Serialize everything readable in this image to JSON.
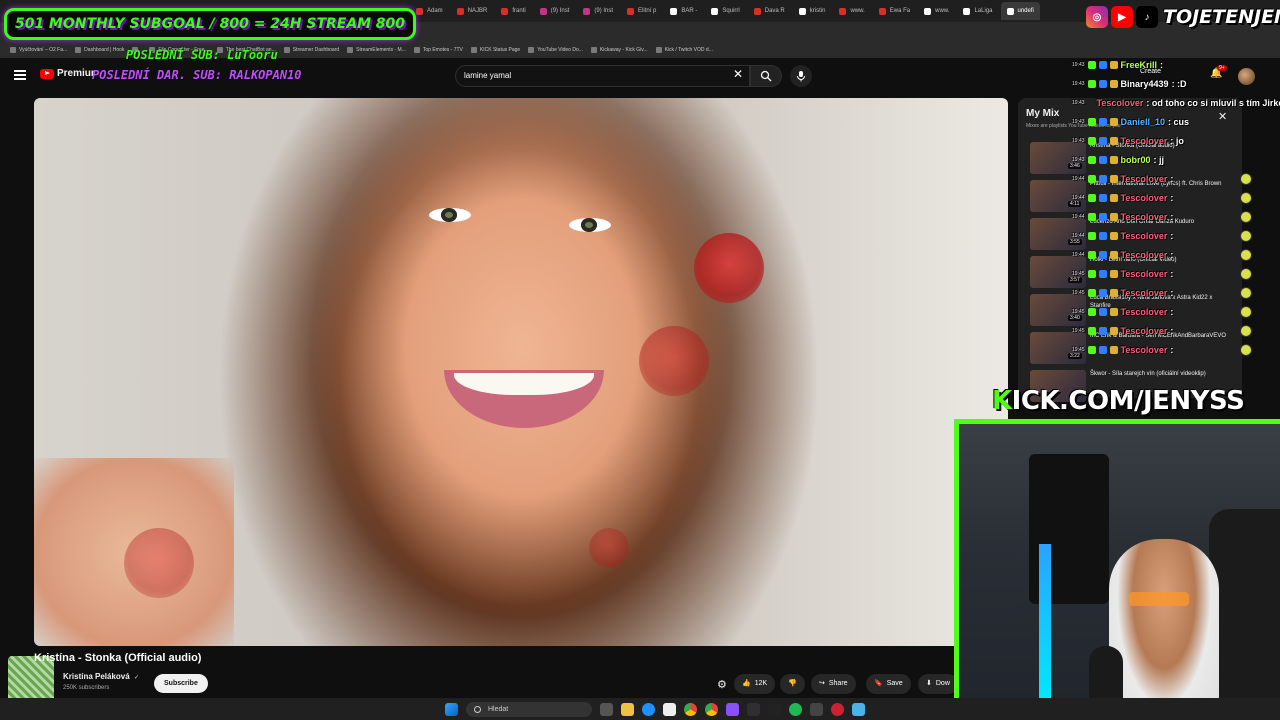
{
  "browser": {
    "tabs": [
      {
        "label": "Adam",
        "color": "#d93025"
      },
      {
        "label": "NAJBR",
        "color": "#d93025"
      },
      {
        "label": "franti",
        "color": "#d93025"
      },
      {
        "label": "(9) Inst",
        "color": "#c13584"
      },
      {
        "label": "(9) Inst",
        "color": "#c13584"
      },
      {
        "label": "Elitní p",
        "color": "#d93025"
      },
      {
        "label": "BAR -",
        "color": "#ffffff"
      },
      {
        "label": "Squirrl",
        "color": "#ffffff"
      },
      {
        "label": "Dava R",
        "color": "#d93025"
      },
      {
        "label": "kristin",
        "color": "#ffffff"
      },
      {
        "label": "www.",
        "color": "#d93025"
      },
      {
        "label": "Ewa Fa",
        "color": "#d93025"
      },
      {
        "label": "www.",
        "color": "#ffffff"
      },
      {
        "label": "LaLiga",
        "color": "#ffffff"
      },
      {
        "label": "undefi",
        "color": "#ffffff"
      }
    ],
    "bookmarks": [
      "Vyúčtování – O2 Fa...",
      "Dashboard | Hook",
      "",
      "File Converter - Free...",
      "The best ChatBot an...",
      "Streamer Dashboard",
      "StreamElements - M...",
      "Top Emotes - 7TV",
      "KICK Status Page",
      "YouTube Video Do...",
      "Kickaway - Kick Giv...",
      "Kick / Twitch VOD d..."
    ]
  },
  "youtube": {
    "logo_label": "Premium",
    "search_value": "lamine yamal",
    "create_label": "Create",
    "notifications_count": "9+",
    "video_title": "Kristína - Stonka (Official audio)",
    "channel_name": "Kristína Peláková",
    "verified_mark": "✓",
    "subscribers": "250K subscribers",
    "subscribe_label": "Subscribe",
    "like_count": "12K",
    "share_label": "Share",
    "save_label": "Save",
    "download_label": "Dow",
    "below_avatar_text": "nce"
  },
  "mix": {
    "title": "My Mix",
    "subtitle": "Mixes are playlists YouTube makes for you",
    "items": [
      {
        "title": "Kristína - Stonka (Official audio)",
        "duration": "3:46"
      },
      {
        "title": "Pitbull - International Love (Lyrics) ft. Chris Brown",
        "duration": "4:11"
      },
      {
        "title": "Lucenzo And Don Omar Danza Kuduro",
        "duration": "3:55"
      },
      {
        "title": "Holki - Letní ráno (Official Video)",
        "duration": "3:57"
      },
      {
        "title": "Luca Brassi10y x Nina Janova x Astra Kid22 x Stanfire",
        "duration": "3:40"
      },
      {
        "title": "MC Erik & Barbara - Sen MCErikAndBarbaraVEVO",
        "duration": "3:22"
      },
      {
        "title": "Škwor - Síla starejch vín (oficiální videoklip)",
        "duration": ""
      }
    ]
  },
  "overlay": {
    "goal_left": "501",
    "goal_text": "MONTHLY SUBGOAL / 800 = 24H STREAM",
    "goal_right": "800",
    "last_sub": "POSLEDNÍ SUB: LuTooru",
    "last_donation": "POSLEDNÍ DAR. SUB: RALKOPAN10",
    "handle": "TOJETENJENYS",
    "kick_prefix": "K",
    "kick_url": "ICK.COM/JENYSS"
  },
  "chat": [
    {
      "time": "19:43",
      "user": "FreeKrill",
      "text": ":",
      "color": "#b8ff5c"
    },
    {
      "time": "19:43",
      "user": "Binary4439",
      "text": ": :D",
      "color": "#ffffff"
    },
    {
      "time": "19:43",
      "user": "Tescolover",
      "text": ": od toho co si mluvil s tím Jirkou",
      "color": "#ff5a7a"
    },
    {
      "time": "19:43",
      "user": "Daniell_10",
      "text": ": cus",
      "color": "#5ab4ff"
    },
    {
      "time": "19:43",
      "user": "Tescolover",
      "text": ": jo",
      "color": "#ff5a7a"
    },
    {
      "time": "19:43",
      "user": "bobr00",
      "text": ": jj",
      "color": "#b8ff5c"
    },
    {
      "time": "19:44",
      "user": "Tescolover",
      "text": ":",
      "color": "#ff5a7a"
    },
    {
      "time": "19:44",
      "user": "Tescolover",
      "text": ":",
      "color": "#ff5a7a"
    },
    {
      "time": "19:44",
      "user": "Tescolover",
      "text": ":",
      "color": "#ff5a7a"
    },
    {
      "time": "19:44",
      "user": "Tescolover",
      "text": ":",
      "color": "#ff5a7a"
    },
    {
      "time": "19:44",
      "user": "Tescolover",
      "text": ":",
      "color": "#ff5a7a"
    },
    {
      "time": "19:45",
      "user": "Tescolover",
      "text": ":",
      "color": "#ff5a7a"
    },
    {
      "time": "19:45",
      "user": "Tescolover",
      "text": ":",
      "color": "#ff5a7a"
    },
    {
      "time": "19:45",
      "user": "Tescolover",
      "text": ":",
      "color": "#ff5a7a"
    },
    {
      "time": "19:45",
      "user": "Tescolover",
      "text": ":",
      "color": "#ff5a7a"
    },
    {
      "time": "19:45",
      "user": "Tescolover",
      "text": ":",
      "color": "#ff5a7a"
    }
  ],
  "taskbar": {
    "search_label": "Hledat"
  }
}
